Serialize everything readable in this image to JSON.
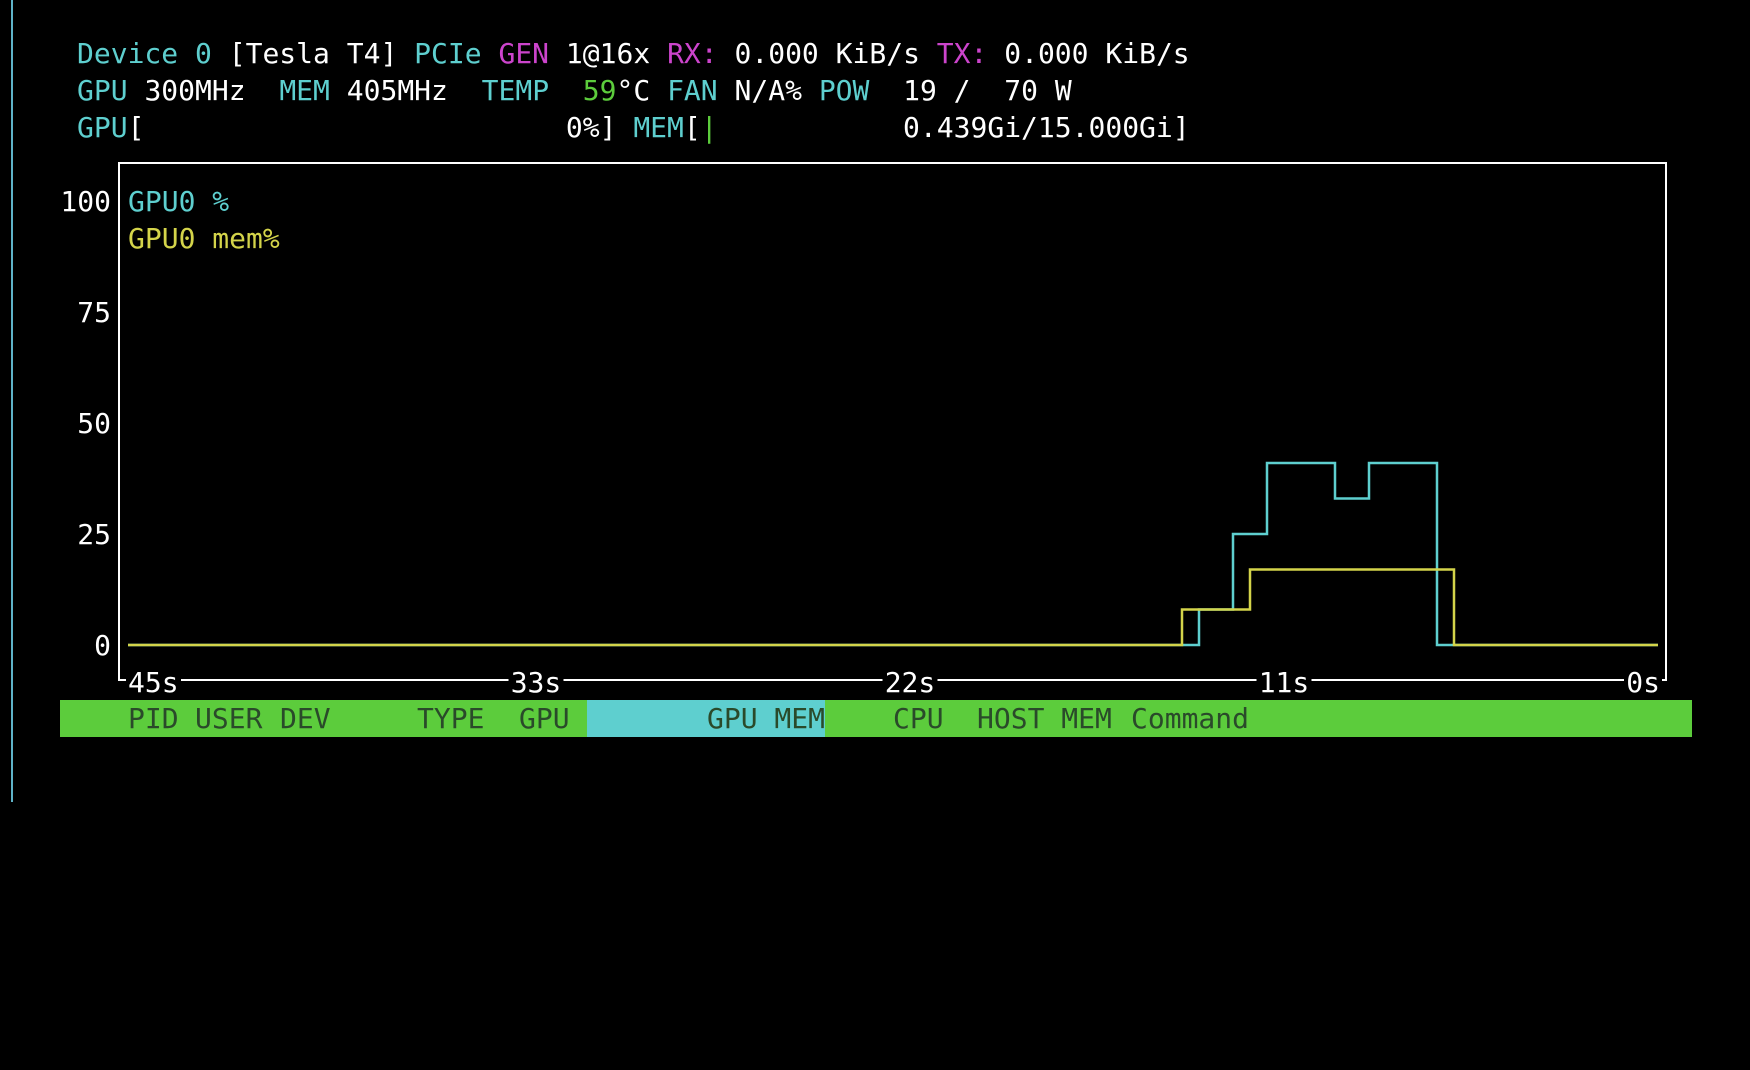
{
  "device": {
    "label": "Device",
    "index": "0",
    "name": "[Tesla T4]",
    "pcie_label": "PCIe",
    "gen_label": "GEN",
    "gen_value": "1@16x",
    "rx_label": "RX:",
    "rx_value": "0.000 KiB/s",
    "tx_label": "TX:",
    "tx_value": "0.000 KiB/s"
  },
  "clocks": {
    "gpu_label": "GPU",
    "gpu_value": "300MHz",
    "mem_label": "MEM",
    "mem_value": "405MHz",
    "temp_label": "TEMP",
    "temp_value": "59",
    "temp_unit": "°C",
    "fan_label": "FAN",
    "fan_value": "N/A%",
    "pow_label": "POW",
    "pow_value": "19 /  70 W"
  },
  "usage": {
    "gpu_label": "GPU",
    "gpu_open": "[",
    "gpu_value": "0%]",
    "gpu_fraction": 0.0,
    "mem_label": "MEM",
    "mem_open": "[",
    "mem_bar_char": "|",
    "mem_value": "0.439Gi/15.000Gi]",
    "mem_fraction": 0.029
  },
  "chart_data": {
    "type": "line",
    "step": true,
    "xlabel": "",
    "ylabel": "",
    "ylim": [
      0,
      100
    ],
    "xlim": [
      -45,
      0
    ],
    "y_ticks": [
      "100",
      "75",
      "50",
      "25",
      "0"
    ],
    "x_ticks": [
      "45s",
      "33s",
      "22s",
      "11s",
      "0s"
    ],
    "x_tick_values": [
      -45,
      -33,
      -22,
      -11,
      0
    ],
    "series": [
      {
        "name": "GPU0 %",
        "color": "#5ecfcf",
        "points": [
          [
            -45,
            0
          ],
          [
            -13.5,
            0
          ],
          [
            -13.5,
            8
          ],
          [
            -12.5,
            8
          ],
          [
            -12.5,
            25
          ],
          [
            -11.5,
            25
          ],
          [
            -11.5,
            41
          ],
          [
            -9.5,
            41
          ],
          [
            -9.5,
            33
          ],
          [
            -8.5,
            33
          ],
          [
            -8.5,
            41
          ],
          [
            -6.5,
            41
          ],
          [
            -6.5,
            0
          ],
          [
            0,
            0
          ]
        ]
      },
      {
        "name": "GPU0 mem%",
        "color": "#d4d44a",
        "points": [
          [
            -45,
            0
          ],
          [
            -14,
            0
          ],
          [
            -14,
            8
          ],
          [
            -12,
            8
          ],
          [
            -12,
            17
          ],
          [
            -6,
            17
          ],
          [
            -6,
            0
          ],
          [
            0,
            0
          ]
        ]
      }
    ]
  },
  "process_header": {
    "pid": "PID",
    "user": "USER",
    "dev": "DEV",
    "type": "TYPE",
    "gpu": "GPU",
    "gpu_mem": "GPU MEM",
    "cpu": "CPU",
    "host_mem": "HOST MEM",
    "command": "Command",
    "bar_color": "#5ccc3c",
    "highlight_color": "#5ecfcf"
  }
}
